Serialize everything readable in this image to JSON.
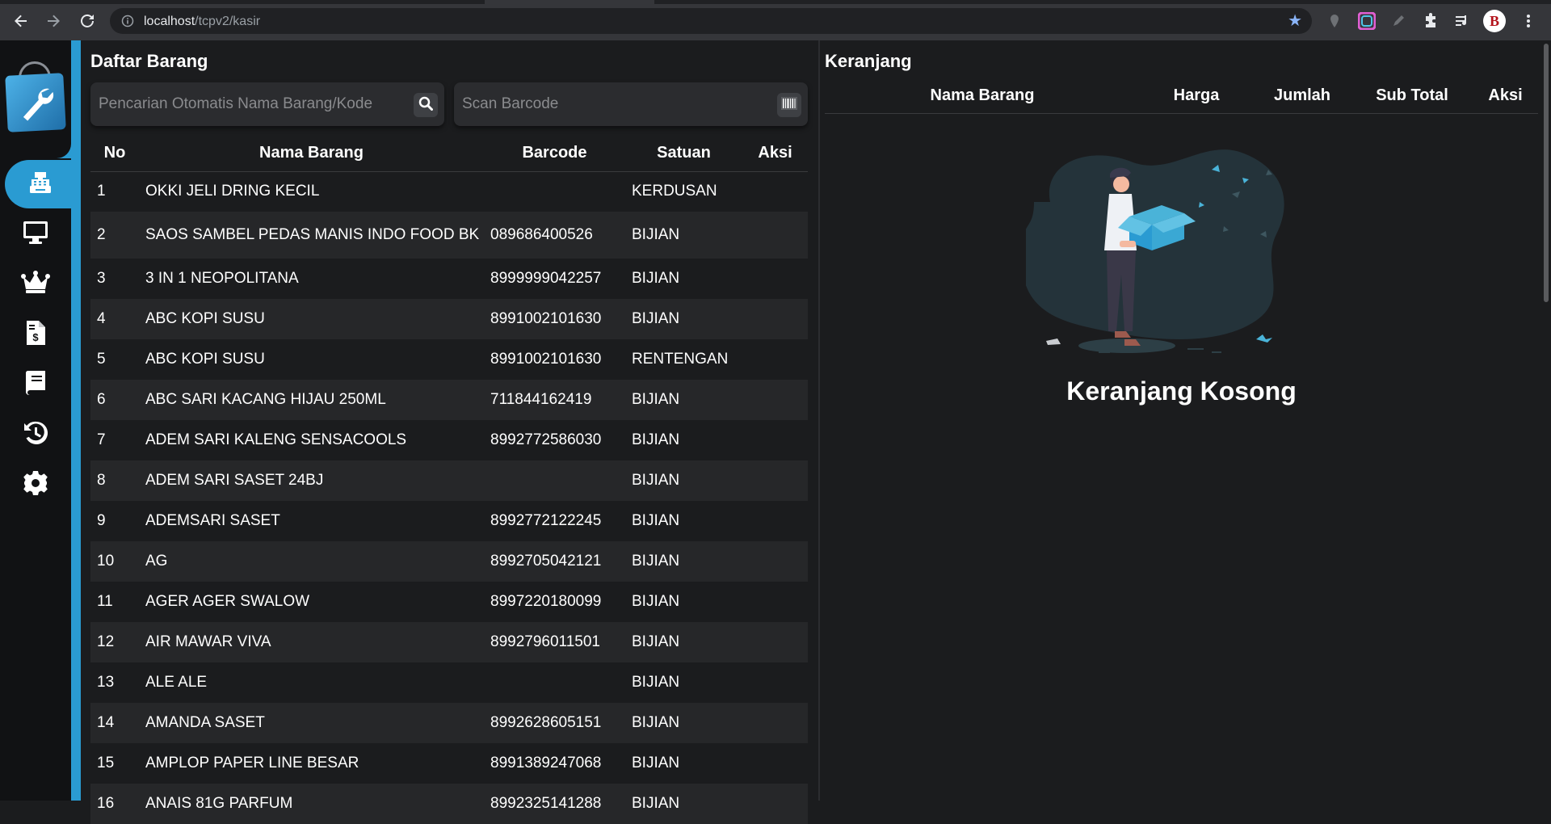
{
  "browser": {
    "url_host": "localhost",
    "url_path": "/tcpv2/kasir",
    "profile_letter": "B"
  },
  "sidebar": {
    "items": [
      {
        "icon": "cash-register-icon",
        "active": true
      },
      {
        "icon": "monitor-icon",
        "active": false
      },
      {
        "icon": "crown-icon",
        "active": false
      },
      {
        "icon": "invoice-icon",
        "active": false
      },
      {
        "icon": "book-icon",
        "active": false
      },
      {
        "icon": "history-icon",
        "active": false
      },
      {
        "icon": "gear-icon",
        "active": false
      }
    ]
  },
  "daftar": {
    "title": "Daftar Barang",
    "search_placeholder": "Pencarian Otomatis Nama Barang/Kode",
    "barcode_placeholder": "Scan Barcode",
    "columns": [
      "No",
      "Nama Barang",
      "Barcode",
      "Satuan",
      "Aksi"
    ],
    "rows": [
      {
        "no": "1",
        "nama": "OKKI JELI DRING KECIL",
        "barcode": "",
        "satuan": "KERDUSAN"
      },
      {
        "no": "2",
        "nama": "SAOS SAMBEL PEDAS MANIS INDO FOOD BK",
        "barcode": "089686400526",
        "satuan": "BIJIAN"
      },
      {
        "no": "3",
        "nama": "3 IN 1 NEOPOLITANA",
        "barcode": "8999999042257",
        "satuan": "BIJIAN"
      },
      {
        "no": "4",
        "nama": "ABC KOPI SUSU",
        "barcode": "8991002101630",
        "satuan": "BIJIAN"
      },
      {
        "no": "5",
        "nama": "ABC KOPI SUSU",
        "barcode": "8991002101630",
        "satuan": "RENTENGAN"
      },
      {
        "no": "6",
        "nama": "ABC SARI KACANG HIJAU 250ML",
        "barcode": "711844162419",
        "satuan": "BIJIAN"
      },
      {
        "no": "7",
        "nama": "ADEM SARI KALENG SENSACOOLS",
        "barcode": "8992772586030",
        "satuan": "BIJIAN"
      },
      {
        "no": "8",
        "nama": "ADEM SARI SASET 24BJ",
        "barcode": "",
        "satuan": "BIJIAN"
      },
      {
        "no": "9",
        "nama": "ADEMSARI SASET",
        "barcode": "8992772122245",
        "satuan": "BIJIAN"
      },
      {
        "no": "10",
        "nama": "AG",
        "barcode": "8992705042121",
        "satuan": "BIJIAN"
      },
      {
        "no": "11",
        "nama": "AGER AGER SWALOW",
        "barcode": "8997220180099",
        "satuan": "BIJIAN"
      },
      {
        "no": "12",
        "nama": "AIR MAWAR VIVA",
        "barcode": "8992796011501",
        "satuan": "BIJIAN"
      },
      {
        "no": "13",
        "nama": "ALE ALE",
        "barcode": "",
        "satuan": "BIJIAN"
      },
      {
        "no": "14",
        "nama": "AMANDA SASET",
        "barcode": "8992628605151",
        "satuan": "BIJIAN"
      },
      {
        "no": "15",
        "nama": "AMPLOP PAPER LINE BESAR",
        "barcode": "8991389247068",
        "satuan": "BIJIAN"
      },
      {
        "no": "16",
        "nama": "ANAIS 81G PARFUM",
        "barcode": "8992325141288",
        "satuan": "BIJIAN"
      }
    ]
  },
  "keranjang": {
    "title": "Keranjang",
    "columns": [
      "Nama Barang",
      "Harga",
      "Jumlah",
      "Sub Total",
      "Aksi"
    ],
    "empty_text": "Keranjang Kosong"
  },
  "colors": {
    "accent": "#2a9bd2",
    "background": "#1b1c1e",
    "row_alt": "#262729"
  }
}
